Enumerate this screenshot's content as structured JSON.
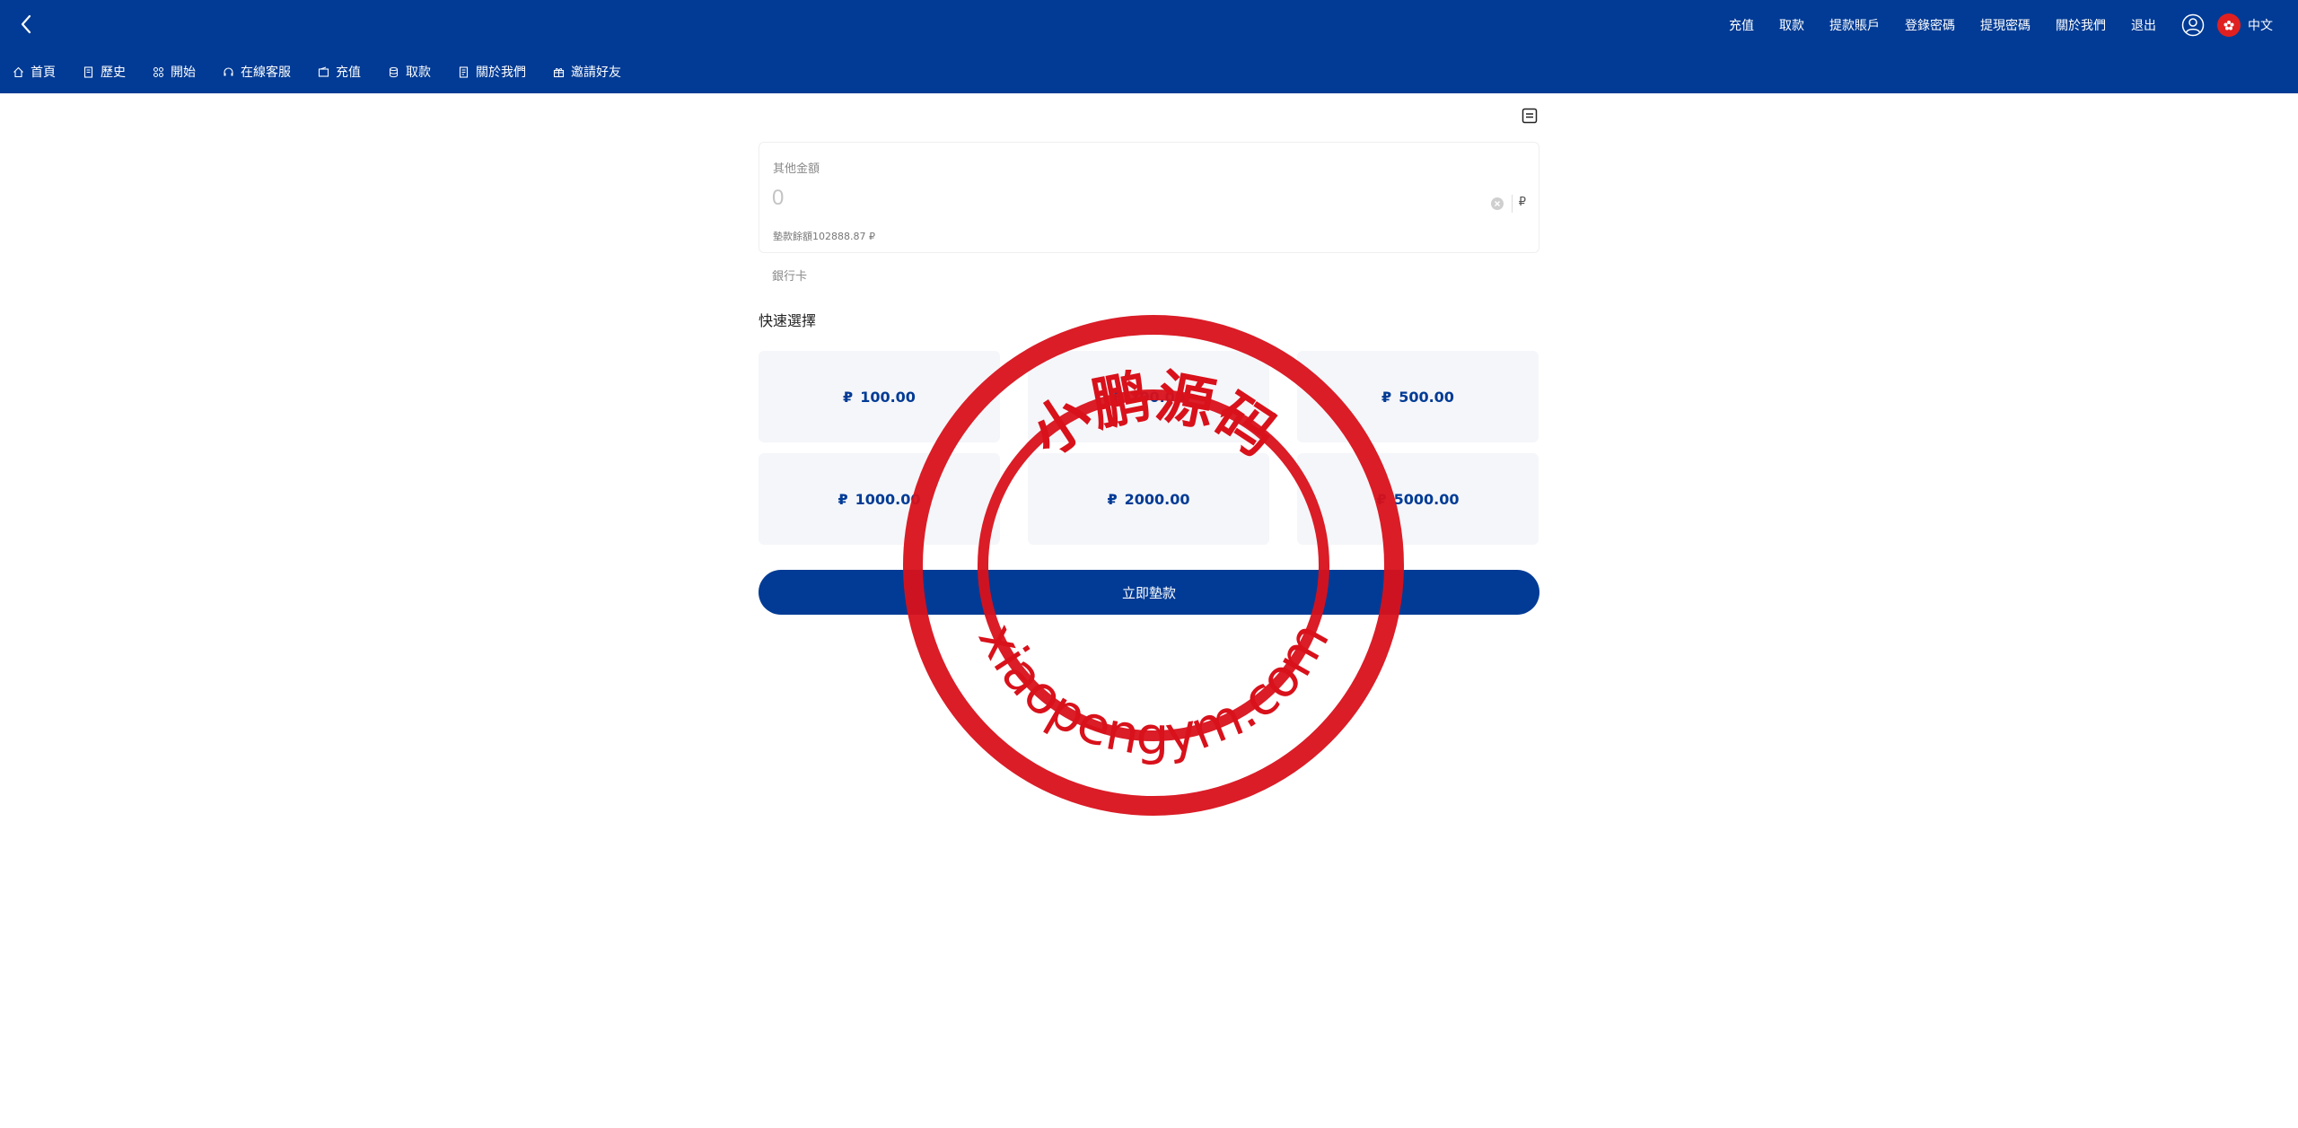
{
  "header": {
    "top_links": [
      "充值",
      "取款",
      "提款賬戶",
      "登錄密碼",
      "提現密碼",
      "關於我們",
      "退出"
    ],
    "language": "中文",
    "sub_nav": [
      {
        "label": "首頁",
        "icon": "home-icon"
      },
      {
        "label": "歷史",
        "icon": "document-icon"
      },
      {
        "label": "開始",
        "icon": "grid-icon"
      },
      {
        "label": "在線客服",
        "icon": "headset-icon"
      },
      {
        "label": "充值",
        "icon": "wallet-icon"
      },
      {
        "label": "取款",
        "icon": "coins-icon"
      },
      {
        "label": "關於我們",
        "icon": "info-doc-icon"
      },
      {
        "label": "邀請好友",
        "icon": "gift-icon"
      }
    ]
  },
  "form": {
    "amount_label": "其他金額",
    "amount_placeholder": "0",
    "unit": "₽",
    "balance": "墊款餘額102888.87 ₽",
    "bank_label": "銀行卡",
    "quick_title": "快速選擇",
    "quick_amounts": [
      "100.00",
      "200.00",
      "500.00",
      "1000.00",
      "2000.00",
      "5000.00"
    ],
    "currency_symbol": "₽",
    "submit_label": "立即墊款"
  },
  "watermark": {
    "top_text": "小鹏源码",
    "bottom_text": "xiaopengym.com"
  },
  "colors": {
    "brand": "#013b95",
    "stamp": "#d8111b"
  }
}
